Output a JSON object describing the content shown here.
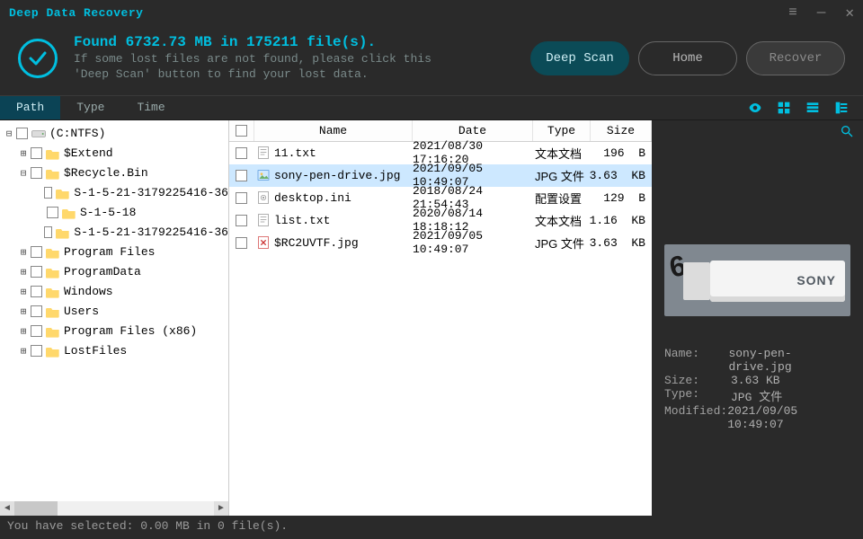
{
  "app_title": "Deep Data Recovery",
  "header": {
    "found_line": "Found 6732.73 MB in 175211 file(s).",
    "hint_line1": "If some lost files are not found, please click this",
    "hint_line2": "'Deep Scan' button to find your lost data.",
    "deep_scan": "Deep Scan",
    "home": "Home",
    "recover": "Recover"
  },
  "tabs": {
    "path": "Path",
    "type": "Type",
    "time": "Time",
    "active": "path"
  },
  "tree": [
    {
      "exp": "-",
      "indent": 0,
      "icon": "drive",
      "label": "(C:NTFS)"
    },
    {
      "exp": "+",
      "indent": 1,
      "icon": "folder",
      "label": "$Extend"
    },
    {
      "exp": "-",
      "indent": 1,
      "icon": "folder",
      "label": "$Recycle.Bin"
    },
    {
      "exp": "",
      "indent": 2,
      "icon": "folder",
      "label": "S-1-5-21-3179225416-36"
    },
    {
      "exp": "",
      "indent": 2,
      "icon": "folder",
      "label": "S-1-5-18"
    },
    {
      "exp": "",
      "indent": 2,
      "icon": "folder",
      "label": "S-1-5-21-3179225416-36"
    },
    {
      "exp": "+",
      "indent": 1,
      "icon": "folder",
      "label": "Program Files"
    },
    {
      "exp": "+",
      "indent": 1,
      "icon": "folder",
      "label": "ProgramData"
    },
    {
      "exp": "+",
      "indent": 1,
      "icon": "folder",
      "label": "Windows"
    },
    {
      "exp": "+",
      "indent": 1,
      "icon": "folder",
      "label": "Users"
    },
    {
      "exp": "+",
      "indent": 1,
      "icon": "folder",
      "label": "Program Files (x86)"
    },
    {
      "exp": "+",
      "indent": 1,
      "icon": "folder",
      "label": "LostFiles"
    }
  ],
  "columns": {
    "name": "Name",
    "date": "Date",
    "type": "Type",
    "size": "Size"
  },
  "files": [
    {
      "icon": "txt",
      "name": "11.txt",
      "date": "2021/08/30 17:16:20",
      "type": "文本文档",
      "size": "196",
      "unit": "B",
      "selected": false
    },
    {
      "icon": "img",
      "name": "sony-pen-drive.jpg",
      "date": "2021/09/05 10:49:07",
      "type": "JPG 文件",
      "size": "3.63",
      "unit": "KB",
      "selected": true
    },
    {
      "icon": "cfg",
      "name": "desktop.ini",
      "date": "2018/08/24 21:54:43",
      "type": "配置设置",
      "size": "129",
      "unit": "B",
      "selected": false
    },
    {
      "icon": "txt",
      "name": "list.txt",
      "date": "2020/08/14 18:18:12",
      "type": "文本文档",
      "size": "1.16",
      "unit": "KB",
      "selected": false
    },
    {
      "icon": "bad",
      "name": "$RC2UVTF.jpg",
      "date": "2021/09/05 10:49:07",
      "type": "JPG 文件",
      "size": "3.63",
      "unit": "KB",
      "selected": false
    }
  ],
  "details": {
    "name_k": "Name:",
    "name_v": "sony-pen-drive.jpg",
    "size_k": "Size:",
    "size_v": "3.63 KB",
    "type_k": "Type:",
    "type_v": "JPG 文件",
    "mod_k": "Modified:",
    "mod_v": "2021/09/05 10:49:07"
  },
  "statusbar": "You have selected: 0.00 MB in 0 file(s)."
}
